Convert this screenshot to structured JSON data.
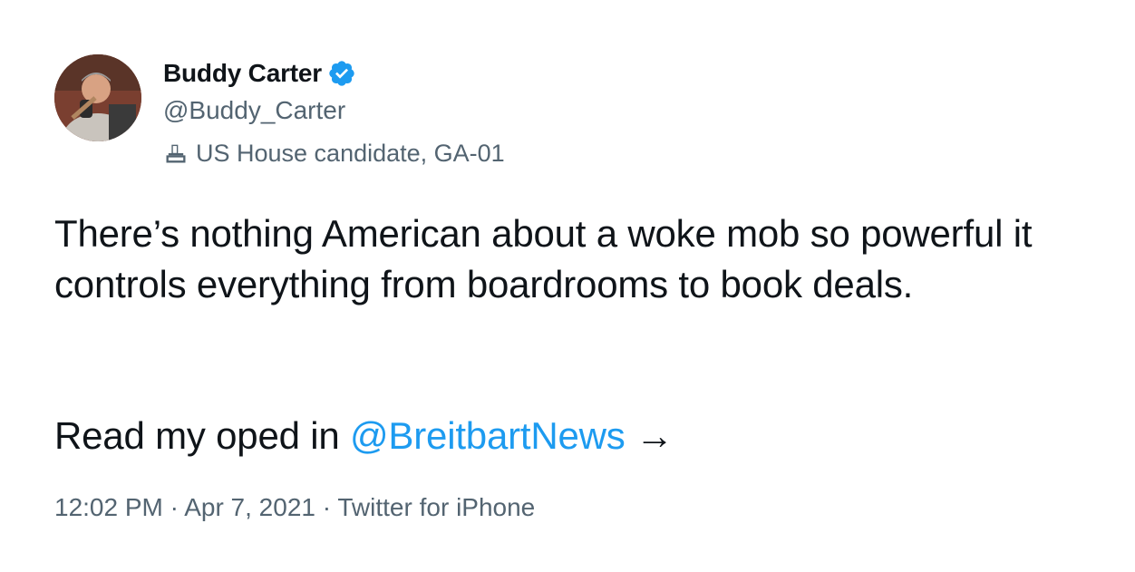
{
  "author": {
    "display_name": "Buddy Carter",
    "handle": "@Buddy_Carter",
    "verified": true,
    "label_icon": "ballot-box-icon",
    "label": "US House candidate, GA-01",
    "avatar_icon": "profile-photo-avatar"
  },
  "tweet": {
    "text": "There’s nothing American about a woke mob so powerful it controls everything from boardrooms to book deals.",
    "read_prefix": "Read my oped in ",
    "mention": "@BreitbartNews",
    "arrow": " →"
  },
  "meta": {
    "time": "12:02 PM",
    "sep1": " · ",
    "date": "Apr 7, 2021",
    "sep2": " · ",
    "source": "Twitter for iPhone"
  },
  "colors": {
    "accent": "#1d9bf0",
    "secondary_text": "#536471",
    "primary_text": "#0f1419"
  }
}
